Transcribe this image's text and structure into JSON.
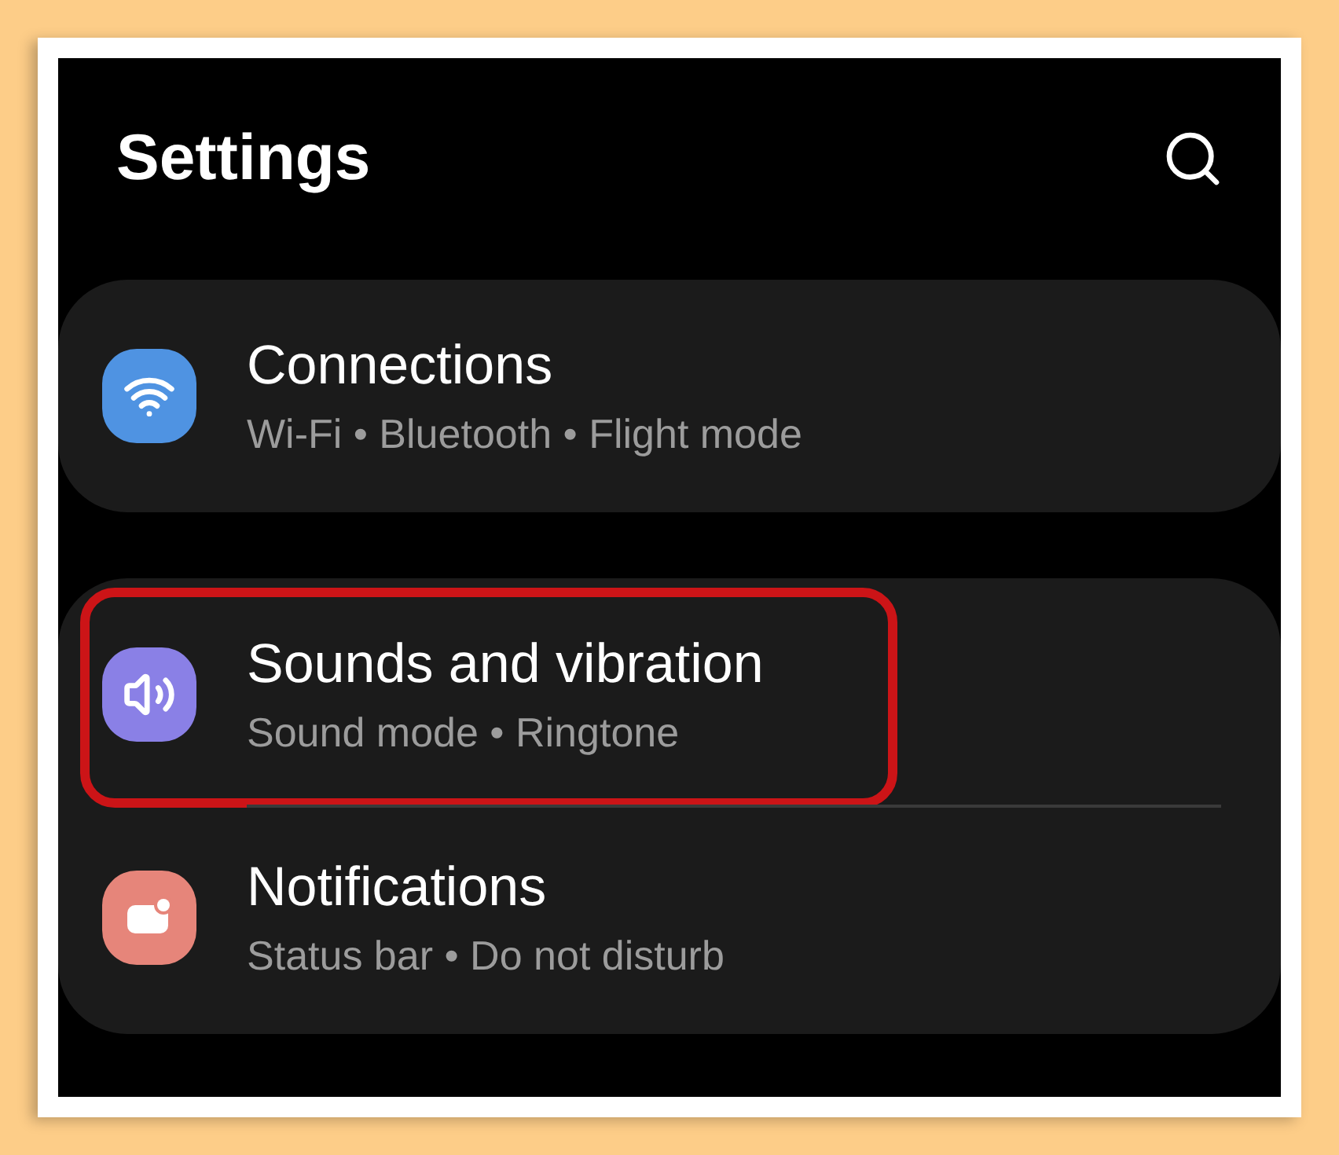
{
  "header": {
    "title": "Settings"
  },
  "groups": [
    {
      "items": [
        {
          "kind": "wifi",
          "title": "Connections",
          "subtitle": "Wi-Fi • Bluetooth • Flight mode",
          "highlighted": false
        }
      ]
    },
    {
      "items": [
        {
          "kind": "sound",
          "title": "Sounds and vibration",
          "subtitle": "Sound mode • Ringtone",
          "highlighted": true
        },
        {
          "kind": "notifications",
          "title": "Notifications",
          "subtitle": "Status bar • Do not disturb",
          "highlighted": false
        }
      ]
    }
  ]
}
